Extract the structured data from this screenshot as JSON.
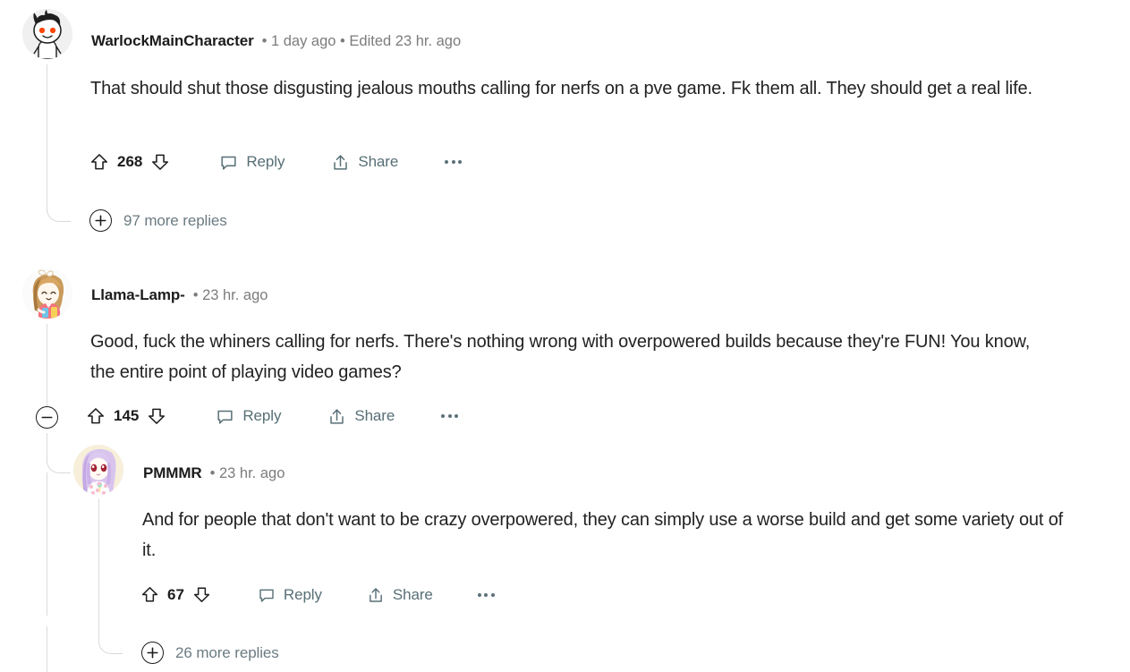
{
  "theme": {
    "background": "#ffffff",
    "body_text": "#222222",
    "username_text": "#1c1c1c",
    "meta_text": "#7c7c7c",
    "action_text": "#576f76",
    "more_replies_text": "#6b7b82",
    "thread_line": "#d7dadc"
  },
  "comments": [
    {
      "avatar": "reddit-snoo-avatar",
      "username": "WarlockMainCharacter",
      "meta": "• 1 day ago • Edited 23 hr. ago",
      "body": "That should shut those disgusting jealous mouths calling for nerfs on a pve game. Fk them all. They should get a real life.",
      "upvote_icon": "upvote-arrow-icon",
      "vote_count": "268",
      "downvote_icon": "downvote-arrow-icon",
      "reply_icon": "comment-bubble-icon",
      "reply_label": "Reply",
      "share_icon": "share-arrow-icon",
      "share_label": "Share",
      "overflow_icon": "more-options-ellipsis-icon",
      "more_replies_icon": "plus-circle-icon",
      "more_replies_label": "97 more replies"
    },
    {
      "avatar": "girl-cartoon-avatar",
      "username": "Llama-Lamp-",
      "meta": "• 23 hr. ago",
      "body": "Good, fuck the whiners calling for nerfs. There's nothing wrong with overpowered builds because they're FUN! You know, the entire point of playing video games?",
      "collapse_icon": "minus-circle-collapse-icon",
      "upvote_icon": "upvote-arrow-icon",
      "vote_count": "145",
      "downvote_icon": "downvote-arrow-icon",
      "reply_icon": "comment-bubble-icon",
      "reply_label": "Reply",
      "share_icon": "share-arrow-icon",
      "share_label": "Share",
      "overflow_icon": "more-options-ellipsis-icon",
      "replies": [
        {
          "avatar": "anime-girl-avatar",
          "username": "PMMMR",
          "meta": "• 23 hr. ago",
          "body": "And for people that don't want to be crazy overpowered, they can simply use a worse build and get some variety out of it.",
          "upvote_icon": "upvote-arrow-icon",
          "vote_count": "67",
          "downvote_icon": "downvote-arrow-icon",
          "reply_icon": "comment-bubble-icon",
          "reply_label": "Reply",
          "share_icon": "share-arrow-icon",
          "share_label": "Share",
          "overflow_icon": "more-options-ellipsis-icon",
          "more_replies_icon": "plus-circle-icon",
          "more_replies_label": "26 more replies"
        }
      ]
    }
  ]
}
